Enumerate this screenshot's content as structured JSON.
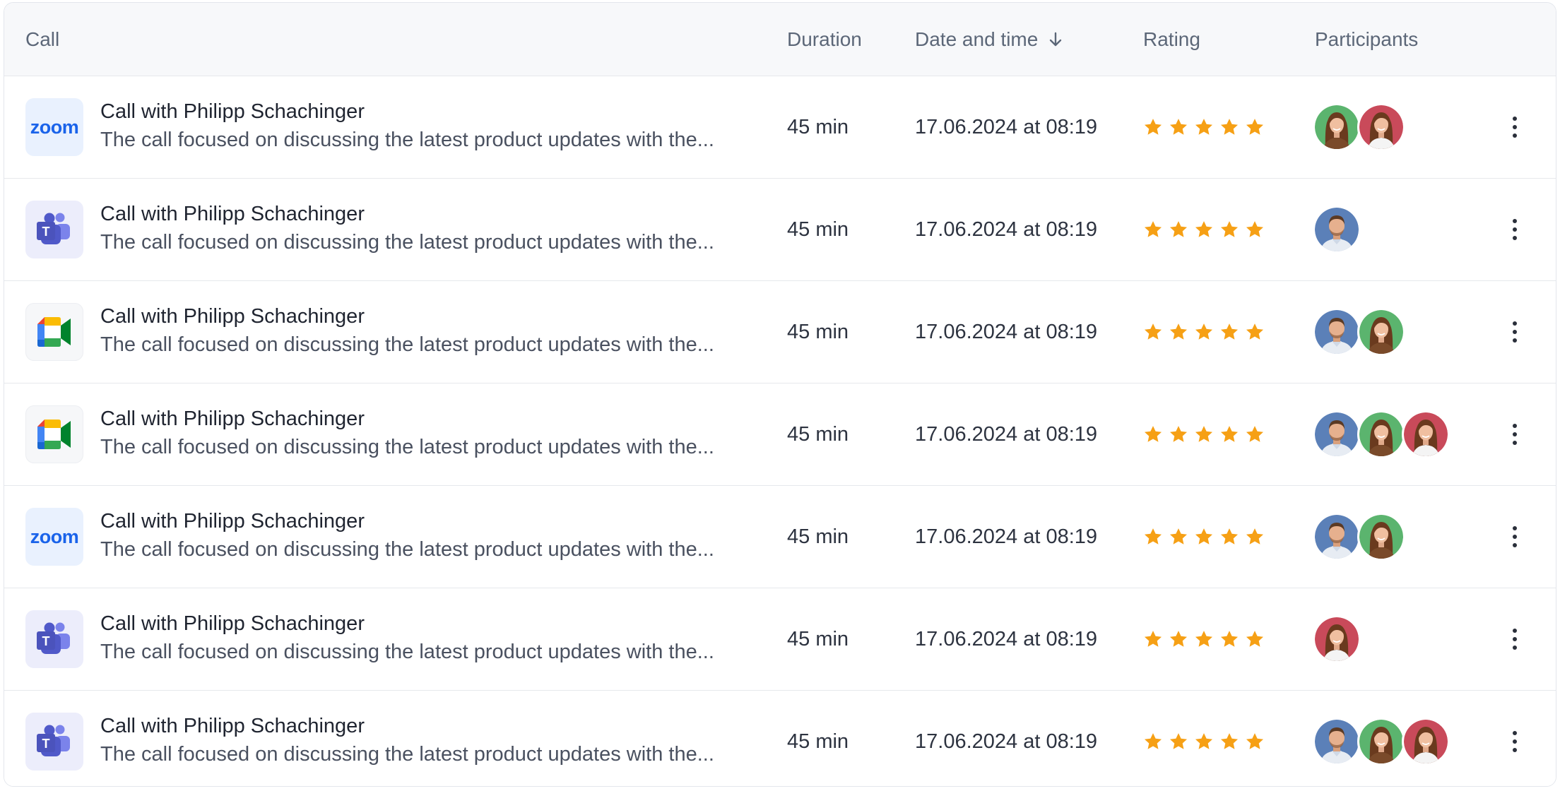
{
  "header": {
    "call": "Call",
    "duration": "Duration",
    "date_time": "Date and time",
    "rating": "Rating",
    "participants": "Participants",
    "sort_icon": "arrow-down-icon"
  },
  "colors": {
    "star": "#f6a015",
    "zoom_blue": "#1a63ea",
    "teams_purple": "#5b5fc7",
    "avatar_man_bg": "#5b80b8",
    "avatar_woman_green_bg": "#5bb46e",
    "avatar_woman_red_bg": "#c94a5a"
  },
  "rows": [
    {
      "app": "zoom",
      "app_label": "zoom",
      "title": "Call with Philipp Schachinger",
      "description": "The call focused on discussing the latest product updates with the...",
      "duration": "45 min",
      "datetime": "17.06.2024 at 08:19",
      "rating": 5,
      "participants": [
        "woman-green",
        "woman-red"
      ]
    },
    {
      "app": "teams",
      "title": "Call with Philipp Schachinger",
      "description": "The call focused on discussing the latest product updates with the...",
      "duration": "45 min",
      "datetime": "17.06.2024 at 08:19",
      "rating": 5,
      "participants": [
        "man-blue"
      ]
    },
    {
      "app": "meet",
      "title": "Call with Philipp Schachinger",
      "description": "The call focused on discussing the latest product updates with the...",
      "duration": "45 min",
      "datetime": "17.06.2024 at 08:19",
      "rating": 5,
      "participants": [
        "man-blue",
        "woman-green"
      ]
    },
    {
      "app": "meet",
      "title": "Call with Philipp Schachinger",
      "description": "The call focused on discussing the latest product updates with the...",
      "duration": "45 min",
      "datetime": "17.06.2024 at 08:19",
      "rating": 5,
      "participants": [
        "man-blue",
        "woman-green",
        "woman-red"
      ]
    },
    {
      "app": "zoom",
      "app_label": "zoom",
      "title": "Call with Philipp Schachinger",
      "description": "The call focused on discussing the latest product updates with the...",
      "duration": "45 min",
      "datetime": "17.06.2024 at 08:19",
      "rating": 5,
      "participants": [
        "man-blue",
        "woman-green"
      ]
    },
    {
      "app": "teams",
      "title": "Call with Philipp Schachinger",
      "description": "The call focused on discussing the latest product updates with the...",
      "duration": "45 min",
      "datetime": "17.06.2024 at 08:19",
      "rating": 5,
      "participants": [
        "woman-red"
      ]
    },
    {
      "app": "teams",
      "title": "Call with Philipp Schachinger",
      "description": "The call focused on discussing the latest product updates with the...",
      "duration": "45 min",
      "datetime": "17.06.2024 at 08:19",
      "rating": 5,
      "participants": [
        "man-blue",
        "woman-green",
        "woman-red"
      ]
    }
  ]
}
